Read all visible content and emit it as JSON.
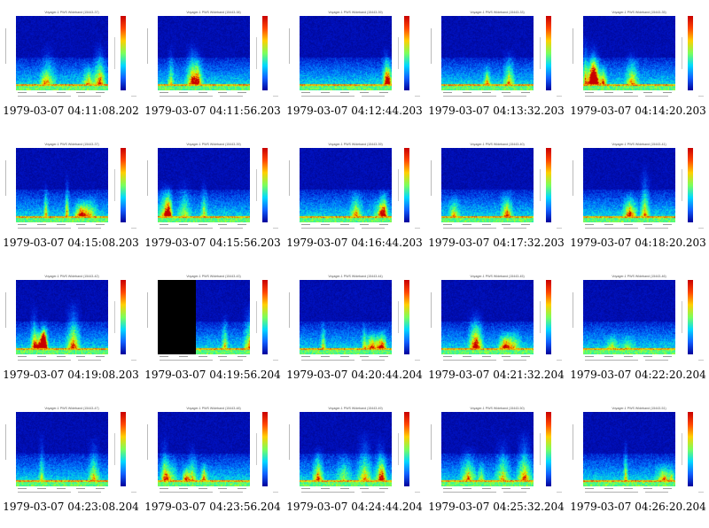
{
  "page": {
    "thumbnails": [
      {
        "title": "Voyager-1 PWS Wideband (15443-37)",
        "caption": "1979-03-07 04:11:08.202",
        "seed": 1
      },
      {
        "title": "Voyager-1 PWS Wideband (15443-38)",
        "caption": "1979-03-07 04:11:56.203",
        "seed": 2
      },
      {
        "title": "Voyager-1 PWS Wideband (15443-39)",
        "caption": "1979-03-07 04:12:44.203",
        "seed": 3
      },
      {
        "title": "Voyager-1 PWS Wideband (15443-33)",
        "caption": "1979-03-07 04:13:32.203",
        "seed": 4
      },
      {
        "title": "Voyager-1 PWS Wideband (15443-35)",
        "caption": "1979-03-07 04:14:20.203",
        "seed": 5
      },
      {
        "title": "Voyager-1 PWS Wideband (15443-37)",
        "caption": "1979-03-07 04:15:08.203",
        "seed": 6
      },
      {
        "title": "Voyager-1 PWS Wideband (15443-39)",
        "caption": "1979-03-07 04:15:56.203",
        "seed": 7
      },
      {
        "title": "Voyager-1 PWS Wideband (15443-39)",
        "caption": "1979-03-07 04:16:44.203",
        "seed": 8
      },
      {
        "title": "Voyager-1 PWS Wideband (15443-40)",
        "caption": "1979-03-07 04:17:32.203",
        "seed": 9
      },
      {
        "title": "Voyager-1 PWS Wideband (15443-41)",
        "caption": "1979-03-07 04:18:20.203",
        "seed": 10
      },
      {
        "title": "Voyager-1 PWS Wideband (15443-42)",
        "caption": "1979-03-07 04:19:08.203",
        "seed": 11
      },
      {
        "title": "Voyager-1 PWS Wideband (15443-43)",
        "caption": "1979-03-07 04:19:56.204",
        "seed": 12,
        "blank_left": true
      },
      {
        "title": "Voyager-1 PWS Wideband (15443-44)",
        "caption": "1979-03-07 04:20:44.204",
        "seed": 13
      },
      {
        "title": "Voyager-1 PWS Wideband (15443-45)",
        "caption": "1979-03-07 04:21:32.204",
        "seed": 14
      },
      {
        "title": "Voyager-1 PWS Wideband (15443-46)",
        "caption": "1979-03-07 04:22:20.204",
        "seed": 15
      },
      {
        "title": "Voyager-1 PWS Wideband (15443-47)",
        "caption": "1979-03-07 04:23:08.204",
        "seed": 16
      },
      {
        "title": "Voyager-1 PWS Wideband (15443-48)",
        "caption": "1979-03-07 04:23:56.204",
        "seed": 17
      },
      {
        "title": "Voyager-1 PWS Wideband (15443-49)",
        "caption": "1979-03-07 04:24:44.204",
        "seed": 18
      },
      {
        "title": "Voyager-1 PWS Wideband (15443-50)",
        "caption": "1979-03-07 04:25:32.204",
        "seed": 19
      },
      {
        "title": "Voyager-1 PWS Wideband (15443-51)",
        "caption": "1979-03-07 04:26:20.204",
        "seed": 20
      }
    ]
  }
}
